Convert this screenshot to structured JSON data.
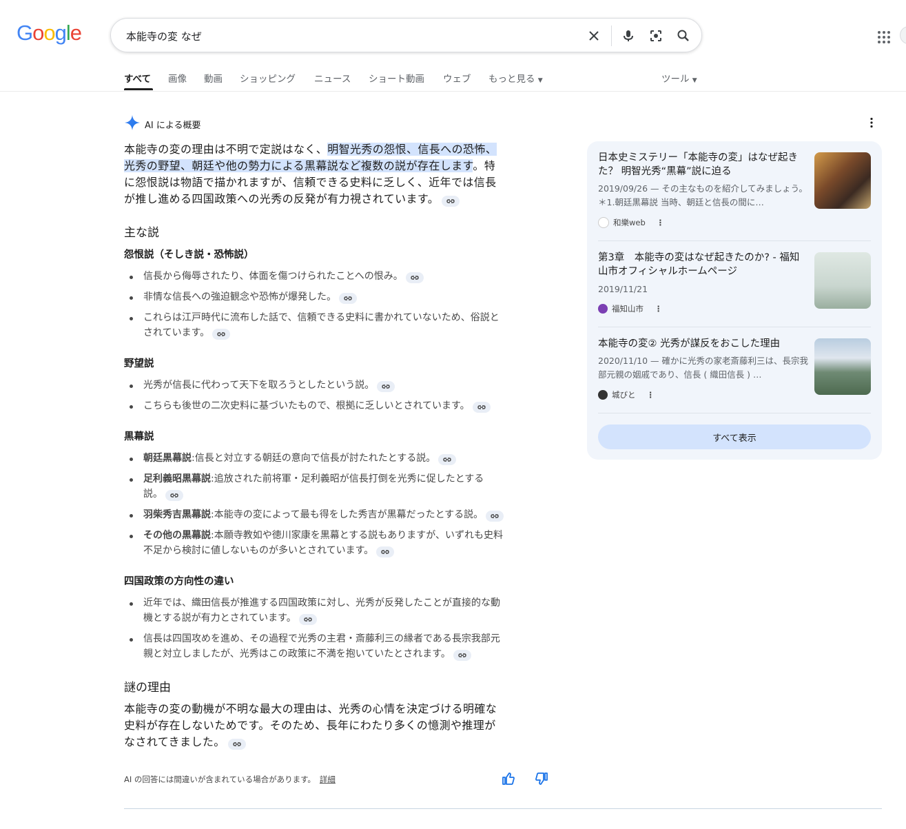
{
  "search": {
    "query": "本能寺の変 なぜ"
  },
  "tabs": [
    "すべて",
    "画像",
    "動画",
    "ショッピング",
    "ニュース",
    "ショート動画",
    "ウェブ",
    "もっと見る"
  ],
  "tools_label": "ツール",
  "ai_overview": {
    "label": "AI による概要",
    "intro_pre": "本能寺の変の理由は不明で定説はなく、",
    "intro_highlight_1": "明智光秀の怨恨、信長への恐怖、",
    "intro_highlight_2": "光秀の野望、朝廷や他の勢力による黒幕説など複数の説が存在します",
    "intro_post_1": "。特",
    "intro_line3": "に怨恨説は物語で描かれますが、信頼できる史料に乏しく、近年では信長",
    "intro_line4": "が推し進める四国政策への光秀の反発が有力視されています。",
    "main_theories_heading": "主な説",
    "grudge": {
      "heading": "怨恨説（そしき説・恐怖説）",
      "items": [
        "信長から侮辱されたり、体面を傷つけられたことへの恨み。",
        "非情な信長への強迫観念や恐怖が爆発した。",
        "これらは江戸時代に流布した話で、信頼できる史料に書かれていないため、俗説と",
        "されています。"
      ]
    },
    "ambition": {
      "heading": "野望説",
      "items": [
        "光秀が信長に代わって天下を取ろうとしたという説。",
        "こちらも後世の二次史料に基づいたもので、根拠に乏しいとされています。"
      ]
    },
    "mastermind": {
      "heading": "黒幕説",
      "items": [
        {
          "bold": "朝廷黒幕説",
          "text": ":信長と対立する朝廷の意向で信長が討たれたとする説。"
        },
        {
          "bold": "足利義昭黒幕説",
          "text": ":追放された前将軍・足利義昭が信長打倒を光秀に促したとする",
          "text2": "説。"
        },
        {
          "bold": "羽柴秀吉黒幕説",
          "text": ":本能寺の変によって最も得をした秀吉が黒幕だったとする説。"
        },
        {
          "bold": "その他の黒幕説",
          "text": ":本願寺教如や徳川家康を黒幕とする説もありますが、いずれも史料",
          "text2": "不足から検討に値しないものが多いとされています。"
        }
      ]
    },
    "shikoku": {
      "heading": "四国政策の方向性の違い",
      "items": [
        "近年では、織田信長が推進する四国政策に対し、光秀が反発したことが直接的な動",
        "機とする説が有力とされています。",
        "信長は四国攻めを進め、その過程で光秀の主君・斎藤利三の縁者である長宗我部元",
        "親と対立しましたが、光秀はこの政策に不満を抱いていたとされます。"
      ]
    },
    "mystery": {
      "heading": "謎の理由",
      "line1": "本能寺の変の動機が不明な最大の理由は、光秀の心情を決定づける明確な",
      "line2": "史料が存在しないためです。そのため、長年にわたり多くの憶測や推理が",
      "line3": "なされてきました。"
    },
    "disclaimer": "AI の回答には間違いが含まれている場合があります。",
    "details_link": "詳細"
  },
  "sources": {
    "cards": [
      {
        "title": "日本史ミステリー「本能寺の変」はなぜ起きた？ 明智光秀“黒幕”説に迫る",
        "snippet": "2019/09/26 — その主なものを紹介してみましょう。＊1.朝廷黒幕説 当時、朝廷と信長の間に…",
        "source": "和樂web",
        "thumb_color": "#7a4a2a"
      },
      {
        "title": "第3章　本能寺の変はなぜ起きたのか? - 福知山市オフィシャルホームページ",
        "snippet": "2019/11/21",
        "source": "福知山市",
        "thumb_color": "#c9d6cf"
      },
      {
        "title": "本能寺の変② 光秀が謀反をおこした理由",
        "snippet": "2020/11/10 — 確かに光秀の家老斎藤利三は、長宗我部元親の姻戚であり、信長 ( 織田信長 ) …",
        "source": "城びと",
        "thumb_color": "#5f7a63"
      }
    ],
    "show_all": "すべて表示"
  },
  "colors": {
    "highlight": "#d3e3fd",
    "panel_bg": "#f1f5fb",
    "link_blue": "#1a73e8"
  }
}
